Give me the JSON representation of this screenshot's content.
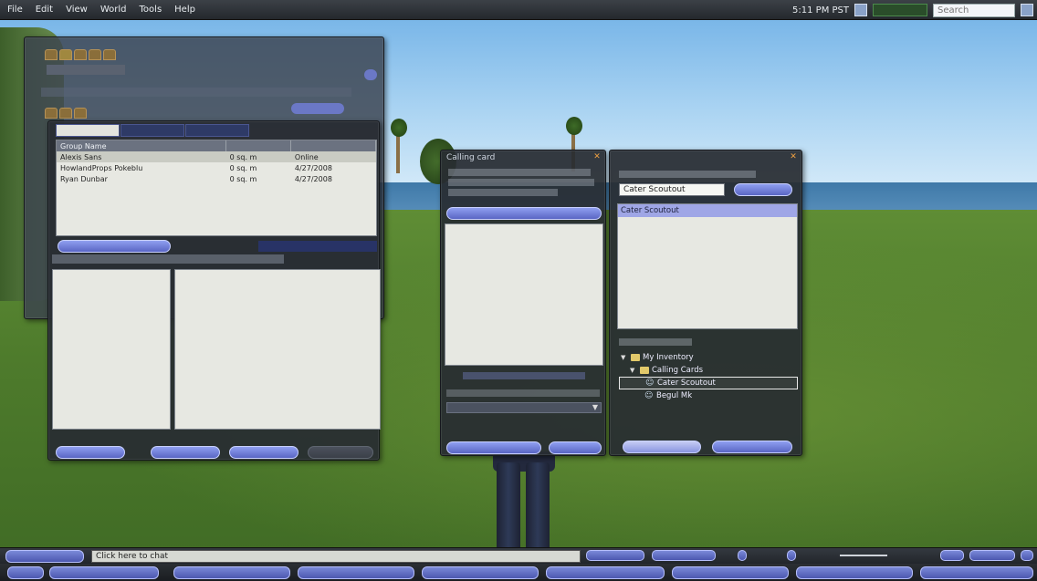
{
  "menubar": {
    "items": [
      "File",
      "Edit",
      "View",
      "World",
      "Tools",
      "Help"
    ],
    "location": "",
    "time": "5:11 PM PST",
    "search_placeholder": "Search"
  },
  "land_window": {
    "tabs": [
      "",
      "",
      "",
      "",
      ""
    ],
    "row2_tabs": [
      "",
      "",
      ""
    ]
  },
  "groups_floater": {
    "subtabs": [
      "",
      "",
      ""
    ],
    "columns": [
      "Group Name",
      "",
      ""
    ],
    "rows": [
      {
        "name": "Alexis Sans",
        "area": "0 sq. m",
        "extra": "Online"
      },
      {
        "name": "HowlandProps Pokeblu",
        "area": "0 sq. m",
        "extra": "4/27/2008"
      },
      {
        "name": "Ryan Dunbar",
        "area": "0 sq. m",
        "extra": "4/27/2008"
      }
    ],
    "buttons": [
      "",
      "",
      "",
      ""
    ]
  },
  "call_card_floater": {
    "title": "Calling card",
    "lines": [],
    "buttons": [
      "",
      ""
    ]
  },
  "inventory_floater": {
    "title": "",
    "search_label": "",
    "search_value": "Cater Scoutout",
    "search_button": "",
    "selected_result": "Cater Scoutout",
    "tree_label": "",
    "tree": [
      {
        "label": "My Inventory",
        "depth": 0,
        "type": "folder"
      },
      {
        "label": "Calling Cards",
        "depth": 1,
        "type": "folder"
      },
      {
        "label": "Cater Scoutout",
        "depth": 2,
        "type": "card",
        "selected": true
      },
      {
        "label": "Begul Mk",
        "depth": 2,
        "type": "card"
      }
    ],
    "buttons": [
      "",
      ""
    ]
  },
  "chat": {
    "left_button": "",
    "placeholder": "Click here to chat"
  },
  "toolbar": {
    "buttons": [
      "",
      "",
      "",
      "",
      "",
      "",
      "",
      ""
    ]
  },
  "colors": {
    "panel": "#2c3036",
    "button": "#6874d6",
    "list_bg": "#e7e8e2",
    "accent_orange": "#f0a040"
  }
}
